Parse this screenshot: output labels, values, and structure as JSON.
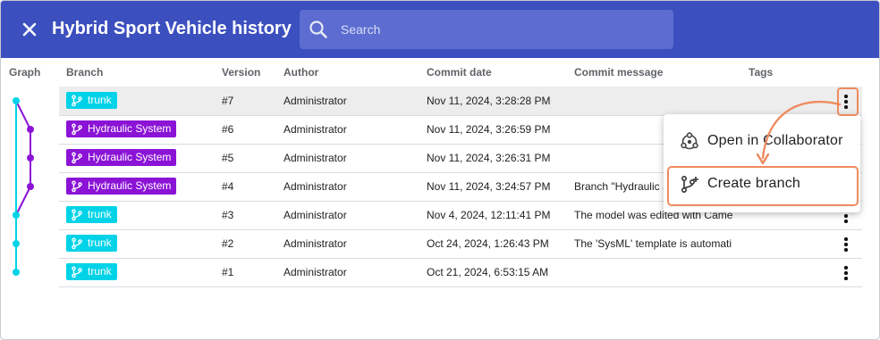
{
  "header": {
    "title": "Hybrid Sport Vehicle history",
    "search_placeholder": "Search"
  },
  "columns": {
    "graph": "Graph",
    "branch": "Branch",
    "version": "Version",
    "author": "Author",
    "commit_date": "Commit date",
    "commit_message": "Commit message",
    "tags": "Tags"
  },
  "rows": [
    {
      "branch": "trunk",
      "branch_kind": "trunk",
      "version": "#7",
      "author": "Administrator",
      "date": "Nov 11, 2024, 3:28:28 PM",
      "message": "",
      "selected": true
    },
    {
      "branch": "Hydraulic System",
      "branch_kind": "feature",
      "version": "#6",
      "author": "Administrator",
      "date": "Nov 11, 2024, 3:26:59 PM",
      "message": ""
    },
    {
      "branch": "Hydraulic System",
      "branch_kind": "feature",
      "version": "#5",
      "author": "Administrator",
      "date": "Nov 11, 2024, 3:26:31 PM",
      "message": ""
    },
    {
      "branch": "Hydraulic System",
      "branch_kind": "feature",
      "version": "#4",
      "author": "Administrator",
      "date": "Nov 11, 2024, 3:24:57 PM",
      "message": "Branch \"Hydraulic S"
    },
    {
      "branch": "trunk",
      "branch_kind": "trunk",
      "version": "#3",
      "author": "Administrator",
      "date": "Nov 4, 2024, 12:11:41 PM",
      "message": "The model was edited with Came"
    },
    {
      "branch": "trunk",
      "branch_kind": "trunk",
      "version": "#2",
      "author": "Administrator",
      "date": "Oct 24, 2024, 1:26:43 PM",
      "message": "The 'SysML' template is automati"
    },
    {
      "branch": "trunk",
      "branch_kind": "trunk",
      "version": "#1",
      "author": "Administrator",
      "date": "Oct 21, 2024, 6:53:15 AM",
      "message": ""
    }
  ],
  "context_menu": {
    "open_label": "Open in Collaborator",
    "create_label": "Create branch"
  },
  "colors": {
    "header": "#3c4fbf",
    "trunk": "#00d3e8",
    "feature": "#8b13d6",
    "highlight": "#ef8a5f"
  }
}
